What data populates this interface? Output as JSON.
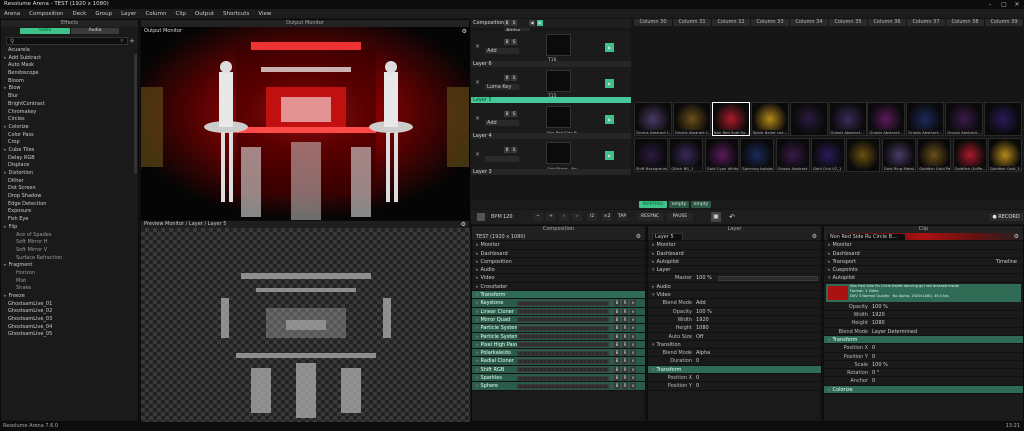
{
  "app": {
    "title": "Resolume Arena - TEST (1920 x 1080)",
    "status": "Resolume Arena 7.6.0",
    "time": "13:21"
  },
  "menu": [
    "Arena",
    "Composition",
    "Deck",
    "Group",
    "Layer",
    "Column",
    "Clip",
    "Output",
    "Shortcuts",
    "View"
  ],
  "effects": {
    "title": "Effects",
    "tabs": [
      "Video",
      "Audio"
    ],
    "search_placeholder": "",
    "items": [
      {
        "t": "Acuarela",
        "k": "item"
      },
      {
        "t": "Add Subtract",
        "k": "grp"
      },
      {
        "t": "Auto Mask",
        "k": "item"
      },
      {
        "t": "Bendoscope",
        "k": "item"
      },
      {
        "t": "Bloom",
        "k": "item"
      },
      {
        "t": "Blow",
        "k": "grp"
      },
      {
        "t": "Blur",
        "k": "item"
      },
      {
        "t": "BrightContrast",
        "k": "item"
      },
      {
        "t": "Chromakey",
        "k": "item"
      },
      {
        "t": "Circles",
        "k": "item"
      },
      {
        "t": "Colorize",
        "k": "grp"
      },
      {
        "t": "Color Pass",
        "k": "item"
      },
      {
        "t": "Crop",
        "k": "item"
      },
      {
        "t": "Cube Tiles",
        "k": "grp"
      },
      {
        "t": "Delay RGB",
        "k": "item"
      },
      {
        "t": "Displace",
        "k": "item"
      },
      {
        "t": "Distortion",
        "k": "grp"
      },
      {
        "t": "Dither",
        "k": "item"
      },
      {
        "t": "Dot Screen",
        "k": "item"
      },
      {
        "t": "Drop Shadow",
        "k": "item"
      },
      {
        "t": "Edge Detection",
        "k": "item"
      },
      {
        "t": "Exposure",
        "k": "item"
      },
      {
        "t": "Fish Eye",
        "k": "item"
      },
      {
        "t": "Flip",
        "k": "grp"
      },
      {
        "t": "Ace of Spades",
        "k": "sub"
      },
      {
        "t": "Soft Mirror H",
        "k": "sub"
      },
      {
        "t": "Soft Mirror V",
        "k": "sub"
      },
      {
        "t": "Surface Refraction",
        "k": "sub"
      },
      {
        "t": "Fragment",
        "k": "grp"
      },
      {
        "t": "Horizon",
        "k": "sub"
      },
      {
        "t": "Mist",
        "k": "sub"
      },
      {
        "t": "Shake",
        "k": "sub"
      },
      {
        "t": "Freeze",
        "k": "grp"
      },
      {
        "t": "GhostsamLive_01",
        "k": "item"
      },
      {
        "t": "GhostsamLive_02",
        "k": "item"
      },
      {
        "t": "GhostsamLive_03",
        "k": "item"
      },
      {
        "t": "GhostsamLive_04",
        "k": "item"
      },
      {
        "t": "GhostsamLive_05",
        "k": "item"
      }
    ]
  },
  "output_monitor": {
    "header": "Output Monitor",
    "label": "Output Monitor"
  },
  "preview_monitor": {
    "label": "Preview Monitor / Layer / Layer 5"
  },
  "composition_header": {
    "label": "Composition",
    "blend": "Alpha"
  },
  "layers": [
    {
      "name": "Layer 6",
      "blend": "Add",
      "clip": "",
      "label": "T16"
    },
    {
      "name": "Layer 5",
      "blend": "Luma Key",
      "clip": "",
      "label": "T15"
    },
    {
      "name": "Layer 4",
      "blend": "Add",
      "clip": "Non Red Side Ru..."
    },
    {
      "name": "Layer 3",
      "blend": "",
      "clip": "Gold Pixels - Ne..."
    }
  ],
  "columns": [
    "Column 30",
    "Column 31",
    "Column 32",
    "Column 33",
    "Column 34",
    "Column 35",
    "Column 36",
    "Column 37",
    "Column 38",
    "Column 39"
  ],
  "clips_row2": [
    "Gnosis Abstract L...",
    "Gnosis Abstract L...",
    "Non Red Side Ru...",
    "Spark Ballet Lee...",
    "",
    "Gnosis Abstract...",
    "Gnosis Abstract...",
    "Gnosis Abstract...",
    "Gnosis Abstract...",
    ""
  ],
  "clips_row3": [
    "Shift Background...",
    "Glitch BG_1",
    "Gold Cyan White...",
    "Spinning Isolated...",
    "Gnosis Abstract L...",
    "Gold Grid V2_1",
    "",
    "Gold Ring Metal...",
    "Goldfish Gold Pe...",
    "Goldfish GldPe...",
    "Goldfish Gold_1..."
  ],
  "deck_tabs": [
    "MAPPING",
    "empty",
    "empty"
  ],
  "transport": {
    "bpm_label": "BPM",
    "bpm": "120",
    "buttons": [
      "−",
      "+",
      "‹",
      "›",
      "/2",
      "×2",
      "TAP",
      "RESYNC",
      "PAUSE"
    ],
    "record": "RECORD"
  },
  "composition_panel": {
    "title": "TEST (1920 x 1080)",
    "header": "Composition",
    "sections": [
      "Monitor",
      "Dashboard",
      "Composition",
      "Audio",
      "Video",
      "Crossfader"
    ],
    "transform": "Transform",
    "effects": [
      "Keystone",
      "Linear Cloner",
      "Mirror Quad",
      "Particle System",
      "Particle System",
      "Pixel High Pass",
      "Polarkaleido",
      "Radial Cloner",
      "Shift RGB",
      "Sparkles",
      "Sphere"
    ]
  },
  "layer_panel": {
    "header": "Layer",
    "name": "Layer 5",
    "sections": [
      "Monitor",
      "Dashboard",
      "Autopilot",
      "Layer"
    ],
    "master_label": "Master",
    "master": "100 %",
    "audio": "Audio",
    "video": "Video",
    "props": [
      {
        "l": "Blend Mode",
        "v": "Add"
      },
      {
        "l": "Opacity",
        "v": "100 %"
      },
      {
        "l": "Width",
        "v": "1920"
      },
      {
        "l": "Height",
        "v": "1080"
      },
      {
        "l": "Auto Size",
        "v": "Off"
      }
    ],
    "transition": "Transition",
    "trans_props": [
      {
        "l": "Blend Mode",
        "v": "Alpha"
      },
      {
        "l": "Duration",
        "v": "0"
      }
    ],
    "transform": "Transform",
    "tf_props": [
      {
        "l": "Position X",
        "v": "0"
      },
      {
        "l": "Position Y",
        "v": "0"
      }
    ]
  },
  "clip_panel": {
    "header": "Clip",
    "name": "Non Red Side Ru Circle B...",
    "sections": [
      "Monitor",
      "Dashboard",
      "Transport",
      "Cuepoints",
      "Autopilot"
    ],
    "transport_val": "Timeline",
    "file": "Non Red Side Ru Circle Ballet dancing girl red dressed inside",
    "file2": "Format: 1 Video",
    "file3": "DXV 3 Normal Quality · No Alpha, 1920x1080, 30.0 fps",
    "props": [
      {
        "l": "Opacity",
        "v": "100 %"
      },
      {
        "l": "Width",
        "v": "1920"
      },
      {
        "l": "Height",
        "v": "1080"
      },
      {
        "l": "Blend Mode",
        "v": "Layer Determined"
      }
    ],
    "transform": "Transform",
    "tf_props": [
      {
        "l": "Position X",
        "v": "0"
      },
      {
        "l": "Position Y",
        "v": "0"
      },
      {
        "l": "Scale",
        "v": "100 %"
      },
      {
        "l": "Rotation",
        "v": "0 °"
      },
      {
        "l": "Anchor",
        "v": "0"
      }
    ],
    "colorize": "Colorize"
  }
}
